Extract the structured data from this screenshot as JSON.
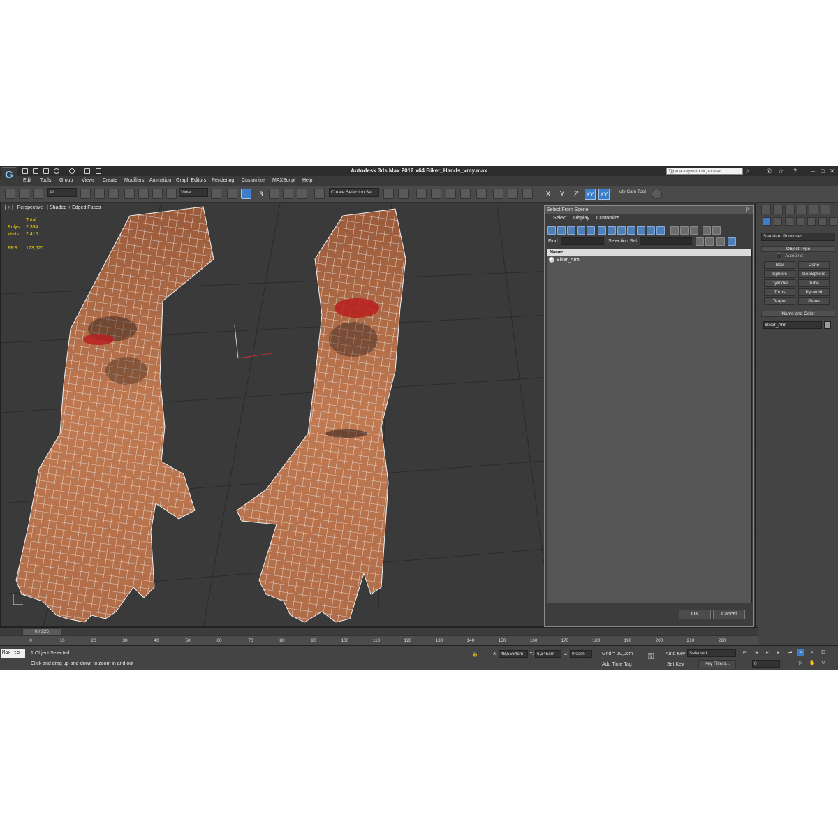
{
  "window": {
    "title": "Autodesk 3ds Max  2012 x64     Biker_Hands_vray.max",
    "search_placeholder": "Type a keyword or phrase"
  },
  "menu": [
    "Edit",
    "Tools",
    "Group",
    "Views",
    "Create",
    "Modifiers",
    "Animation",
    "Graph Editors",
    "Rendering",
    "Customize",
    "MAXScript",
    "Help"
  ],
  "toolbar": {
    "filter_value": "All",
    "ref_coord_value": "View",
    "named_selection_placeholder": "Create Selection Se",
    "snap_label": "3",
    "axis_x": "X",
    "axis_y": "Y",
    "axis_z": "Z",
    "axis_xy": "XY",
    "axis_xy2": "XY",
    "cam_tool": "uty Cam Tool"
  },
  "viewport": {
    "label": "[ + ] [ Perspective ] [ Shaded + Edged Faces ]",
    "stats_total": "Total",
    "polys_label": "Polys:",
    "polys_value": "2 394",
    "verts_label": "Verts:",
    "verts_value": "2 416",
    "fps_label": "FPS:",
    "fps_value": "173,620"
  },
  "dialog": {
    "title": "Select From Scene",
    "menu_select": "Select",
    "menu_display": "Display",
    "menu_customize": "Customize",
    "find_label": "Find:",
    "selset_label": "Selection Set:",
    "column_name": "Name",
    "objects": [
      "Biker_Arm"
    ],
    "ok": "OK",
    "cancel": "Cancel"
  },
  "command_panel": {
    "category": "Standard Primitives",
    "object_type_title": "Object Type",
    "autogrid": "AutoGrid",
    "primitives": [
      "Box",
      "Cone",
      "Sphere",
      "GeoSphere",
      "Cylinder",
      "Tube",
      "Torus",
      "Pyramid",
      "Teapot",
      "Plane"
    ],
    "name_color_title": "Name and Color",
    "object_name": "Biker_Arm"
  },
  "timeline": {
    "slider": "0 / 225",
    "ticks": [
      "0",
      "10",
      "20",
      "30",
      "40",
      "50",
      "60",
      "70",
      "80",
      "90",
      "100",
      "110",
      "120",
      "130",
      "140",
      "150",
      "160",
      "170",
      "180",
      "190",
      "200",
      "210",
      "220"
    ]
  },
  "status": {
    "maxscript": "Max to",
    "objects_selected": "1 Object Selected",
    "prompt": "Click and drag up-and-down to zoom in and out",
    "x_label": "X:",
    "x_value": "48,5564cm",
    "y_label": "Y:",
    "y_value": "6,345cm",
    "z_label": "Z:",
    "z_value": "0,0cm",
    "grid": "Grid = 10,0cm",
    "add_time_tag": "Add Time Tag",
    "auto_key": "Auto Key",
    "set_key": "Set Key",
    "selected": "Selected",
    "key_filters": "Key Filters...",
    "frame": "0"
  }
}
